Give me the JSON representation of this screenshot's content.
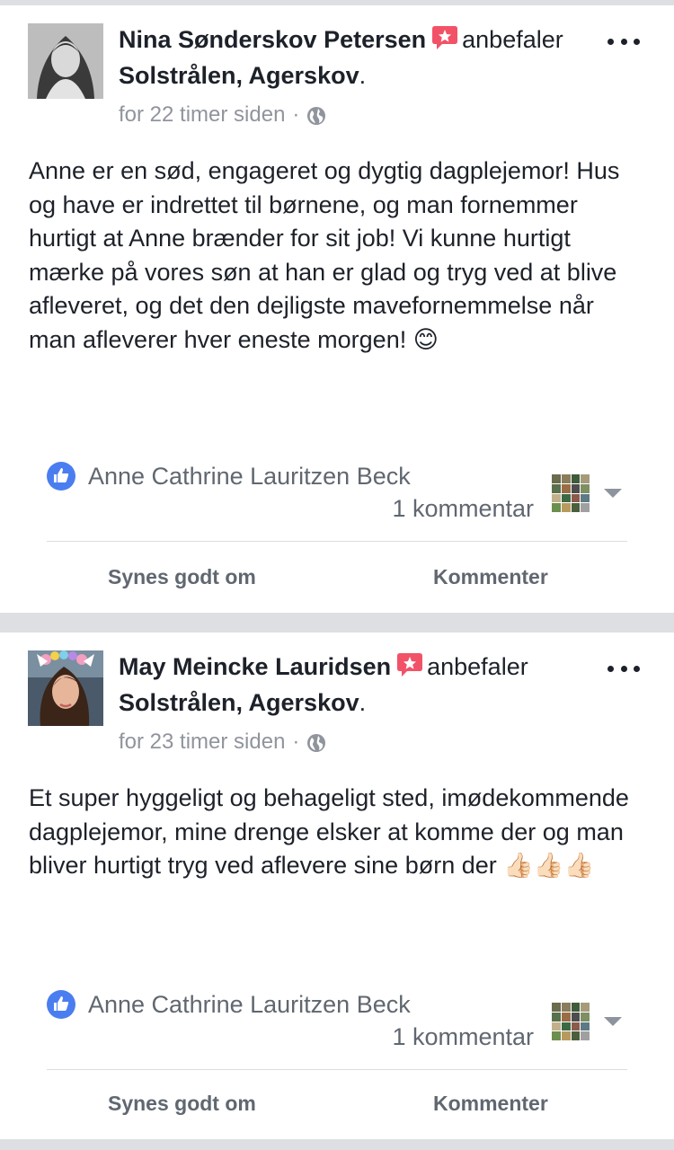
{
  "posts": [
    {
      "author": "Nina Sønderskov Petersen",
      "verb": "anbefaler",
      "page": "Solstrålen, Agerskov",
      "page_suffix": ".",
      "time": "for 22 timer siden",
      "separator": "·",
      "privacy_icon": "globe-icon",
      "text": "Anne er en sød, engageret og dygtig dagplejemor! Hus og have er indrettet til børnene, og man fornemmer hurtigt at Anne brænder for sit job! Vi kunne hurtigt mærke på vores søn at han er glad og tryg ved at blive afleveret, og det den dejligste mavefornemmelse når man afleverer hver eneste morgen! 😊",
      "liker": "Anne Cathrine Lauritzen Beck",
      "comment_count": "1 kommentar",
      "like_label": "Synes godt om",
      "comment_label": "Kommenter"
    },
    {
      "author": "May Meincke Lauridsen",
      "verb": "anbefaler",
      "page": "Solstrålen, Agerskov",
      "page_suffix": ".",
      "time": "for 23 timer siden",
      "separator": "·",
      "privacy_icon": "globe-icon",
      "text": "Et super hyggeligt og behageligt sted, imødekommende dagplejemor, mine drenge elsker at komme der og man bliver hurtigt tryg ved aflevere sine børn der 👍🏻👍🏻👍🏻",
      "liker": "Anne Cathrine Lauritzen Beck",
      "comment_count": "1 kommentar",
      "like_label": "Synes godt om",
      "comment_label": "Kommenter"
    }
  ],
  "colors": {
    "recommend_badge": "#f25268",
    "like_badge": "#4a7ef0",
    "text_primary": "#1d2129",
    "text_secondary": "#606770",
    "meta": "#90949c"
  }
}
